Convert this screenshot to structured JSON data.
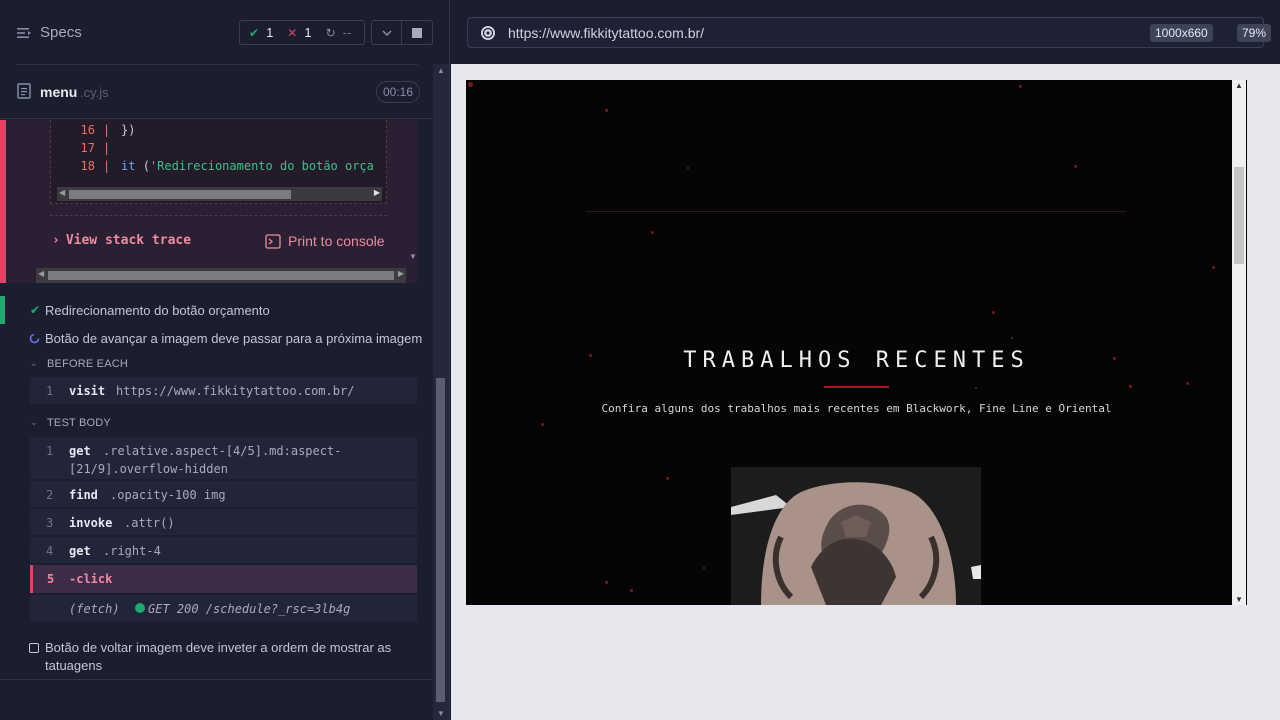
{
  "sidebar": {
    "title": "Specs",
    "stats": {
      "passed": "1",
      "failed": "1",
      "pending": "--"
    }
  },
  "spec": {
    "name": "menu",
    "ext": ".cy.js",
    "duration": "00:16"
  },
  "error": {
    "code_lines": [
      {
        "num": "16",
        "text": "    })"
      },
      {
        "num": "17",
        "text": ""
      },
      {
        "num": "18",
        "text": "    it ('Redirecionamento do botão orça"
      }
    ],
    "view_stack": "View stack trace",
    "print": "Print to console"
  },
  "tests": {
    "t1": "Redirecionamento do botão orçamento",
    "t2": "Botão de avançar a imagem deve passar para a próxima imagem",
    "t3_line1": "Botão de voltar imagem deve inveter a ordem de mostrar as",
    "t3_line2": "tatuagens"
  },
  "sections": {
    "before_each": "BEFORE EACH",
    "test_body": "TEST BODY"
  },
  "commands": {
    "visit": {
      "n": "1",
      "k": "visit",
      "a": "https://www.fikkitytattoo.com.br/"
    },
    "body": [
      {
        "n": "1",
        "k": "get",
        "a1": ".relative.aspect-[4/5].md:aspect-",
        "a2": "[21/9].overflow-hidden"
      },
      {
        "n": "2",
        "k": "find",
        "a1": ".opacity-100 img"
      },
      {
        "n": "3",
        "k": "invoke",
        "a1": ".attr()"
      },
      {
        "n": "4",
        "k": "get",
        "a1": ".right-4"
      },
      {
        "n": "5",
        "k": "-click",
        "a1": ""
      }
    ],
    "fetch": {
      "label": "(fetch)",
      "text": "GET 200 /schedule?_rsc=3lb4g"
    }
  },
  "browser": {
    "url": "https://www.fikkitytattoo.com.br/",
    "viewport": "1000x660",
    "zoom": "79%"
  },
  "site": {
    "title": "TRABALHOS RECENTES",
    "subtitle": "Confira alguns dos trabalhos mais recentes em Blackwork, Fine Line e Oriental"
  },
  "colors": {
    "accent_fail": "#e04664",
    "accent_pass": "#1fa971",
    "running": "#6470f3"
  }
}
